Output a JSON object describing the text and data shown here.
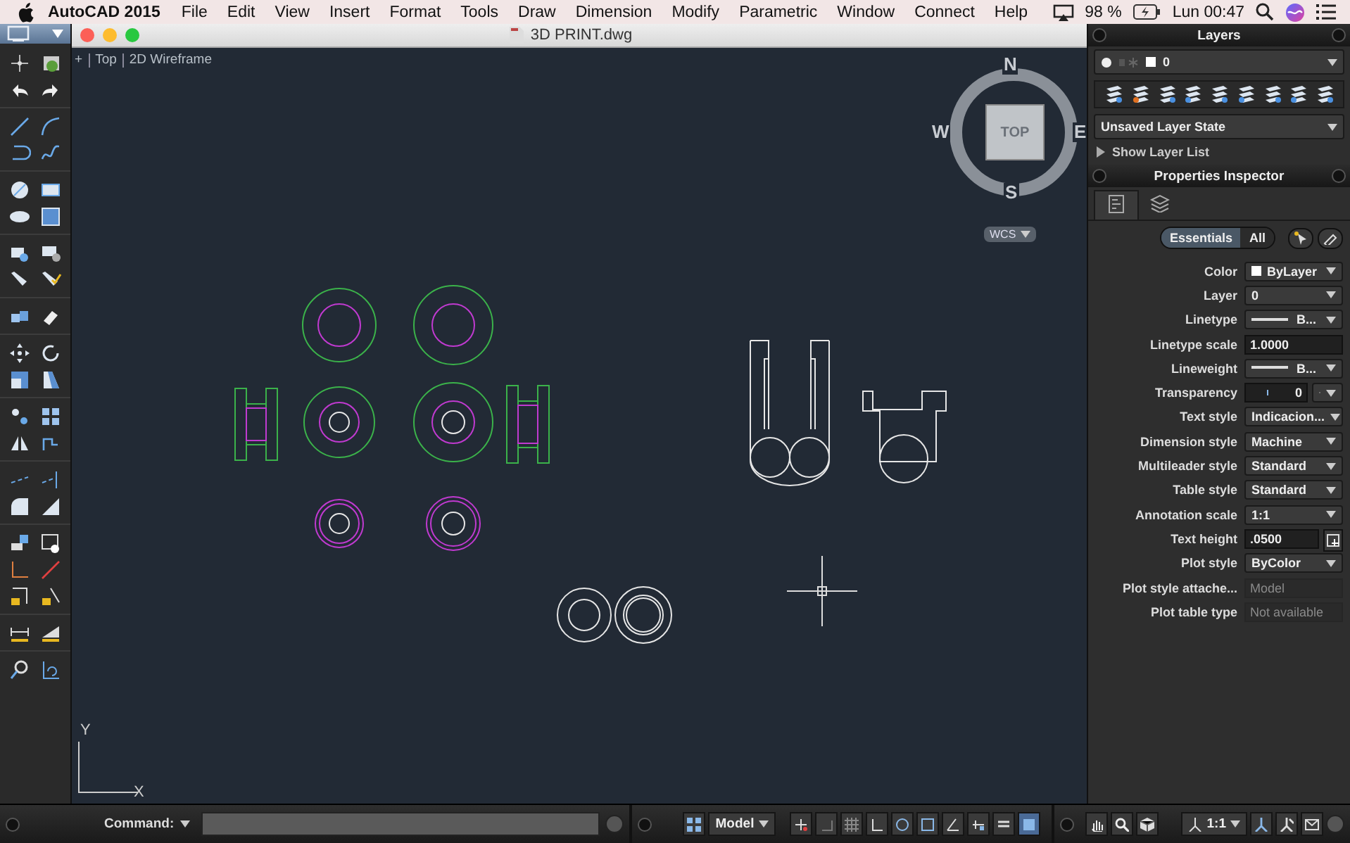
{
  "menu_bar": {
    "app": "AutoCAD 2015",
    "menus": [
      "File",
      "Edit",
      "View",
      "Insert",
      "Format",
      "Tools",
      "Draw",
      "Dimension",
      "Modify",
      "Parametric",
      "Window",
      "Connect",
      "Help"
    ],
    "battery": "98 %",
    "clock": "Lun 00:47"
  },
  "window": {
    "title": "3D PRINT.dwg"
  },
  "viewport": {
    "controls": [
      "+",
      "Top",
      "2D Wireframe"
    ],
    "viewcube": {
      "face": "TOP",
      "north": "N",
      "west": "W",
      "east": "E",
      "south": "S",
      "ucs": "WCS"
    },
    "axis": {
      "y": "Y",
      "x": "X"
    }
  },
  "layers_panel": {
    "title": "Layers",
    "current_layer": "0",
    "layer_state": "Unsaved Layer State",
    "show_list": "Show Layer List"
  },
  "properties": {
    "title": "Properties Inspector",
    "tabs": [
      {
        "selected": true
      },
      {
        "selected": false
      }
    ],
    "segments": [
      {
        "label": "Essentials",
        "selected": true
      },
      {
        "label": "All",
        "selected": false
      }
    ],
    "rows": [
      {
        "label": "Color",
        "value": "ByLayer",
        "kind": "color"
      },
      {
        "label": "Layer",
        "value": "0",
        "kind": "dropdown"
      },
      {
        "label": "Linetype",
        "value": "B...",
        "kind": "linetype"
      },
      {
        "label": "Linetype scale",
        "value": "1.0000",
        "kind": "field"
      },
      {
        "label": "Lineweight",
        "value": "B...",
        "kind": "linetype"
      },
      {
        "label": "Transparency",
        "value": "0",
        "kind": "transparency"
      },
      {
        "label": "Text style",
        "value": "Indicacion...",
        "kind": "dropdown"
      },
      {
        "label": "Dimension style",
        "value": "Machine",
        "kind": "dropdown"
      },
      {
        "label": "Multileader style",
        "value": "Standard",
        "kind": "dropdown"
      },
      {
        "label": "Table style",
        "value": "Standard",
        "kind": "dropdown"
      },
      {
        "label": "Annotation scale",
        "value": "1:1",
        "kind": "dropdown"
      },
      {
        "label": "Text height",
        "value": ".0500",
        "kind": "field_button"
      },
      {
        "label": "Plot style",
        "value": "ByColor",
        "kind": "dropdown"
      },
      {
        "label": "Plot style attache...",
        "value": "Model",
        "kind": "readonly"
      },
      {
        "label": "Plot table type",
        "value": "Not available",
        "kind": "readonly"
      }
    ]
  },
  "command_line": {
    "label": "Command:"
  },
  "status_bar": {
    "space": "Model",
    "scale": "1:1"
  }
}
